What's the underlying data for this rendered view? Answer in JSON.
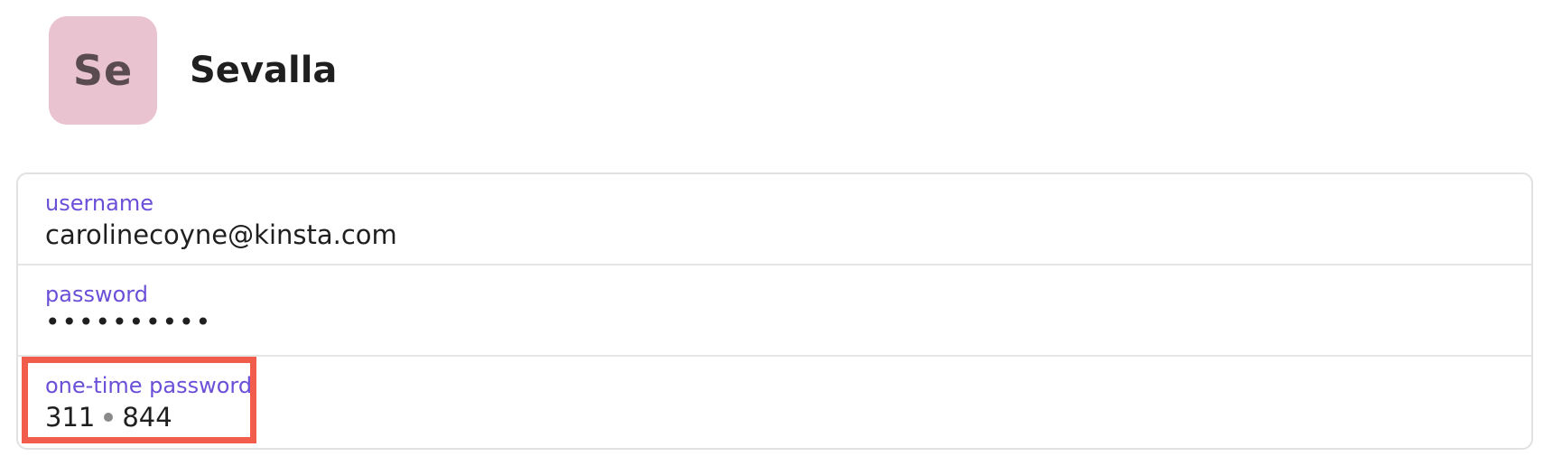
{
  "header": {
    "avatar_text": "Se",
    "title": "Sevalla"
  },
  "fields": {
    "username": {
      "label": "username",
      "value": "carolinecoyne@kinsta.com"
    },
    "password": {
      "label": "password",
      "value": "••••••••••"
    },
    "otp": {
      "label": "one-time password",
      "first": "311",
      "second": "844"
    }
  },
  "colors": {
    "label": "#6b4fd8",
    "avatar_bg": "#e9c3cf",
    "highlight": "#f25c4a"
  }
}
